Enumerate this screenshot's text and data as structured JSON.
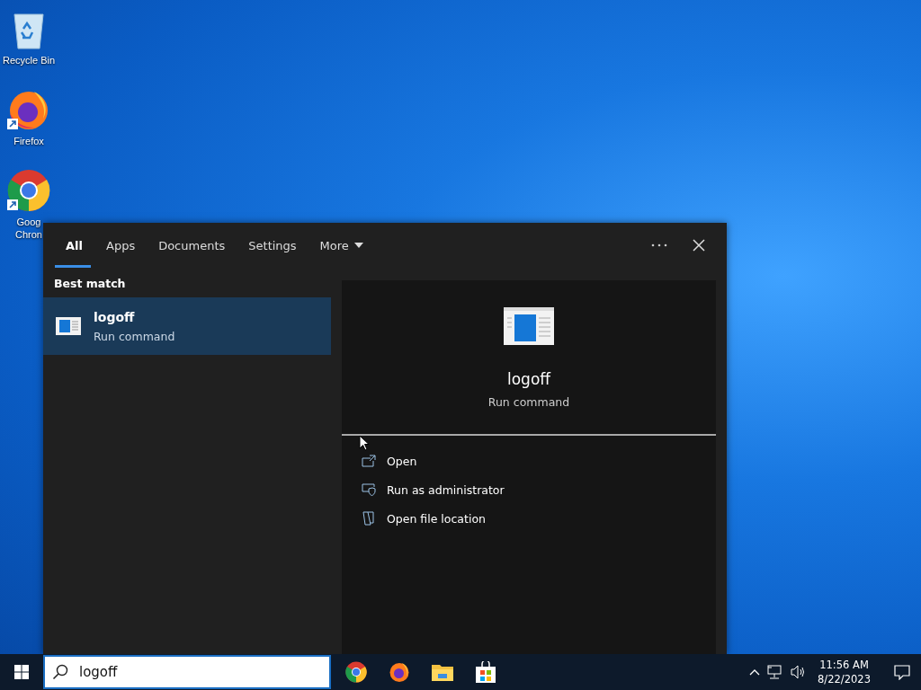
{
  "desktop_icons": [
    {
      "label": "Recycle Bin",
      "kind": "recycle",
      "shortcut": false
    },
    {
      "label": "Firefox",
      "kind": "firefox",
      "shortcut": true
    },
    {
      "label": "Goog\nChron",
      "kind": "chrome",
      "shortcut": true
    }
  ],
  "search_panel": {
    "tabs": [
      {
        "label": "All",
        "selected": true,
        "dropdown": false
      },
      {
        "label": "Apps",
        "selected": false,
        "dropdown": false
      },
      {
        "label": "Documents",
        "selected": false,
        "dropdown": false
      },
      {
        "label": "Settings",
        "selected": false,
        "dropdown": false
      },
      {
        "label": "More",
        "selected": false,
        "dropdown": true
      }
    ],
    "section_heading": "Best match",
    "results": [
      {
        "title": "logoff",
        "subtitle": "Run command",
        "selected": true
      }
    ],
    "preview": {
      "title": "logoff",
      "subtitle": "Run command"
    },
    "actions": [
      {
        "label": "Open",
        "kind": "open"
      },
      {
        "label": "Run as administrator",
        "kind": "admin"
      },
      {
        "label": "Open file location",
        "kind": "folder"
      }
    ]
  },
  "taskbar": {
    "search": {
      "value": "logoff"
    },
    "pinned": [
      {
        "kind": "chrome"
      },
      {
        "kind": "firefox"
      },
      {
        "kind": "explorer"
      },
      {
        "kind": "store"
      }
    ],
    "clock": {
      "time": "11:56 AM",
      "date": "8/22/2023"
    }
  }
}
